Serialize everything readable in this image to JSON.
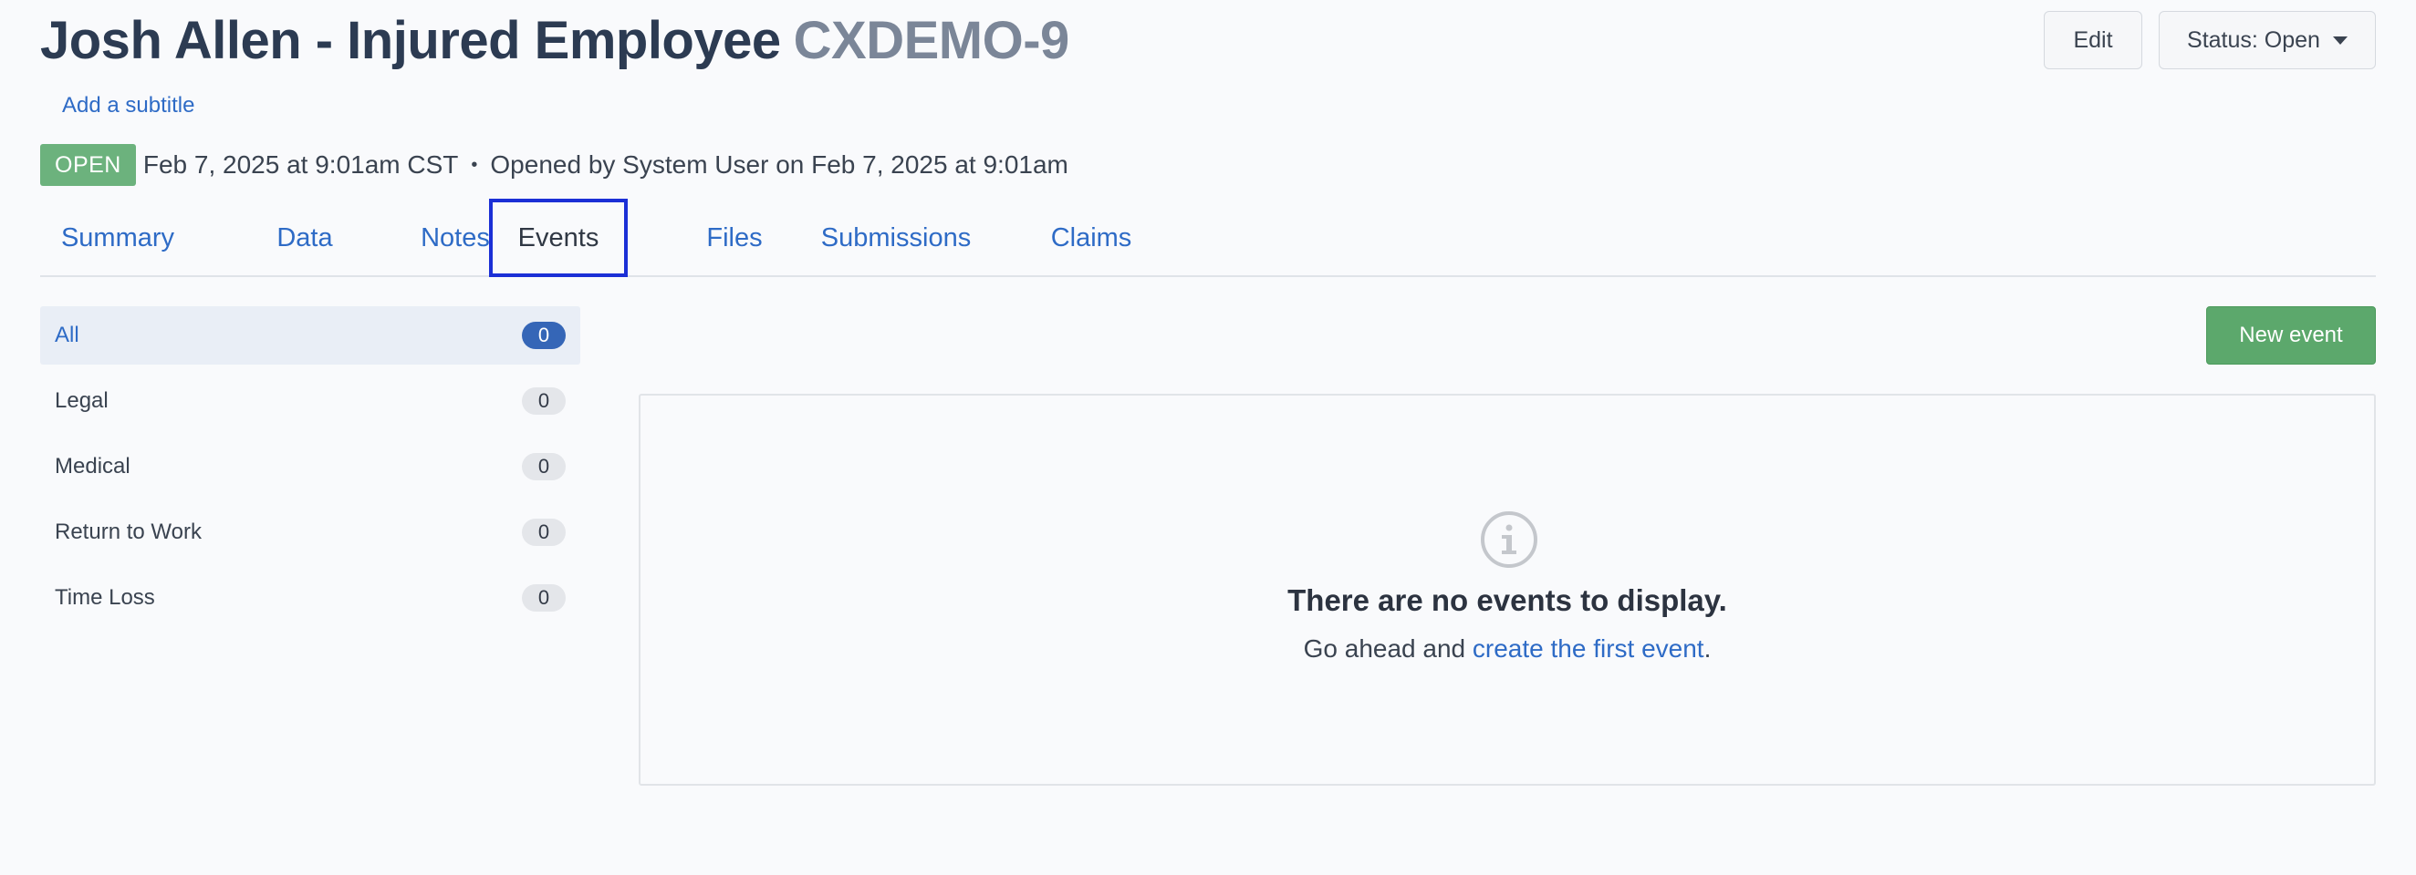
{
  "header": {
    "title": "Josh Allen - Injured Employee",
    "case_id": "CXDEMO-9",
    "subtitle_link": "Add a subtitle",
    "status_badge": "OPEN",
    "created_at": "Feb 7, 2025 at 9:01am CST",
    "separator": "•",
    "opened_by": "Opened by System User on Feb 7, 2025 at 9:01am",
    "edit_label": "Edit",
    "status_label": "Status: Open"
  },
  "tabs": [
    {
      "label": "Summary",
      "active": false
    },
    {
      "label": "Data",
      "active": false
    },
    {
      "label": "Notes",
      "active": false
    },
    {
      "label": "Events",
      "active": true
    },
    {
      "label": "Files",
      "active": false
    },
    {
      "label": "Submissions",
      "active": false
    },
    {
      "label": "Claims",
      "active": false
    }
  ],
  "sidebar": {
    "filters": [
      {
        "label": "All",
        "count": "0",
        "active": true
      },
      {
        "label": "Legal",
        "count": "0"
      },
      {
        "label": "Medical",
        "count": "0"
      },
      {
        "label": "Return to Work",
        "count": "0"
      },
      {
        "label": "Time Loss",
        "count": "0"
      }
    ]
  },
  "main": {
    "new_event_label": "New event",
    "empty_title": "There are no events to display.",
    "empty_prefix": "Go ahead and ",
    "empty_link": "create the first event",
    "empty_suffix": ".",
    "icon": "info-circle-icon"
  },
  "colors": {
    "accent": "#2e6bc6",
    "open_badge": "#6cb27d",
    "new_button": "#5ca86c",
    "active_tab_outline": "#1b2fd6",
    "active_count": "#3566b7"
  }
}
